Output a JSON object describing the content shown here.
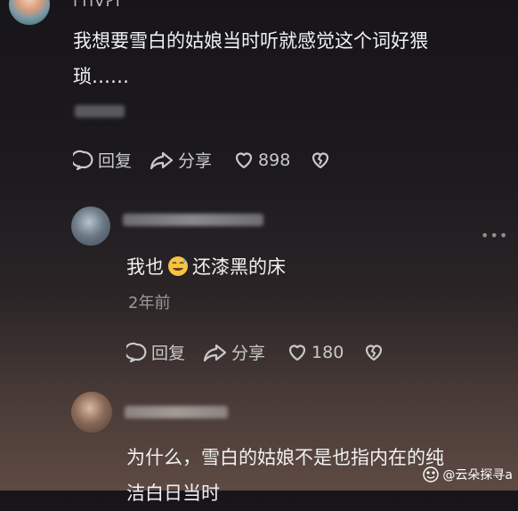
{
  "comment1": {
    "username": "ᒥᑎᐯᓰᒥ",
    "text_line1": "我想要雪白的姑娘当时听就感觉这个词好猥",
    "text_line2": "琐……",
    "actions": {
      "reply": "回复",
      "share": "分享",
      "likes": "898"
    }
  },
  "reply1": {
    "text_before_emoji": "我也",
    "emoji": "sweat-smile-emoji",
    "text_after_emoji": "还漆黑的床",
    "time": "2年前",
    "actions": {
      "reply": "回复",
      "share": "分享",
      "likes": "180"
    },
    "more": "•••"
  },
  "reply2": {
    "text_line1": "为什么，雪白的姑娘不是也指内在的纯",
    "text_line2": "洁白日当时"
  },
  "watermark": {
    "text": "@云朵探寻a"
  },
  "colors": {
    "background_top": "#171519",
    "background_bottom": "#5e4a43",
    "text": "#f1f1f1",
    "muted": "#9a9a9a"
  }
}
